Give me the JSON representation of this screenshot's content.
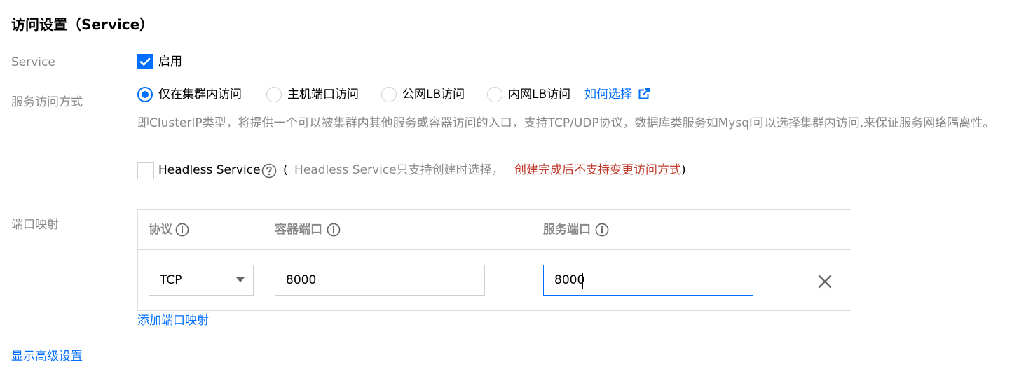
{
  "section": {
    "title": "访问设置（Service）"
  },
  "service": {
    "label": "Service",
    "enable_label": "启用",
    "enabled": true
  },
  "access_mode": {
    "label": "服务访问方式",
    "options": [
      {
        "label": "仅在集群内访问",
        "selected": true
      },
      {
        "label": "主机端口访问",
        "selected": false
      },
      {
        "label": "公网LB访问",
        "selected": false
      },
      {
        "label": "内网LB访问",
        "selected": false
      }
    ],
    "help_link": "如何选择",
    "description": "即ClusterIP类型，将提供一个可以被集群内其他服务或容器访问的入口，支持TCP/UDP协议，数据库类服务如Mysql可以选择集群内访问,来保证服务网络隔离性。",
    "headless_label": "Headless Service",
    "headless_checked": false,
    "headless_paren_open": "(",
    "headless_note_gray": "Headless Service只支持创建时选择，",
    "headless_note_red": "创建完成后不支持变更访问方式",
    "headless_paren_close": ")"
  },
  "port_mapping": {
    "label": "端口映射",
    "columns": [
      "协议",
      "容器端口",
      "服务端口"
    ],
    "rows": [
      {
        "protocol": "TCP",
        "container_port": "8000",
        "service_port": "8000"
      }
    ],
    "add_link": "添加端口映射"
  },
  "advanced_link": "显示高级设置",
  "colors": {
    "accent": "#006eff",
    "label_gray": "#888888",
    "warning_red": "#c0392b",
    "border": "#dddddd"
  }
}
